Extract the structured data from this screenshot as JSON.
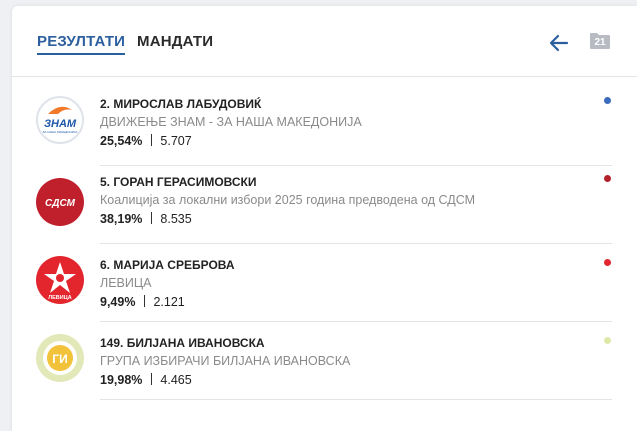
{
  "tabs": {
    "results": "РЕЗУЛТАТИ",
    "mandates": "МАНДАТИ"
  },
  "toolbar": {
    "folder_count": "21"
  },
  "candidates": [
    {
      "name": "2. МИРОСЛАВ ЛАБУДОВИЌ",
      "party": "ДВИЖЕЊЕ ЗНАМ - ЗА НАША МАКЕДОНИЈА",
      "percent": "25,54%",
      "votes": "5.707",
      "color": "#3b6bbd",
      "logo_text": "ЗНАМ",
      "logo_subtext": "ЗА НАША МАКЕДОНИЈА"
    },
    {
      "name": "5. ГОРАН ГЕРАСИМОВСКИ",
      "party": "Коалиција за локални избори 2025 година предводена од СДСМ",
      "percent": "38,19%",
      "votes": "8.535",
      "color": "#b3202a",
      "logo_text": "СДСМ"
    },
    {
      "name": "6. МАРИЈА СРЕБРОВА",
      "party": "ЛЕВИЦА",
      "percent": "9,49%",
      "votes": "2.121",
      "color": "#e3262e",
      "logo_text": "ЛЕВИЦА"
    },
    {
      "name": "149. БИЛЈАНА ИВАНОВСКА",
      "party": "ГРУПА ИЗБИРАЧИ БИЛЈАНА ИВАНОВСКА",
      "percent": "19,98%",
      "votes": "4.465",
      "color": "#dfe7a8",
      "logo_text": "ГИ"
    }
  ]
}
